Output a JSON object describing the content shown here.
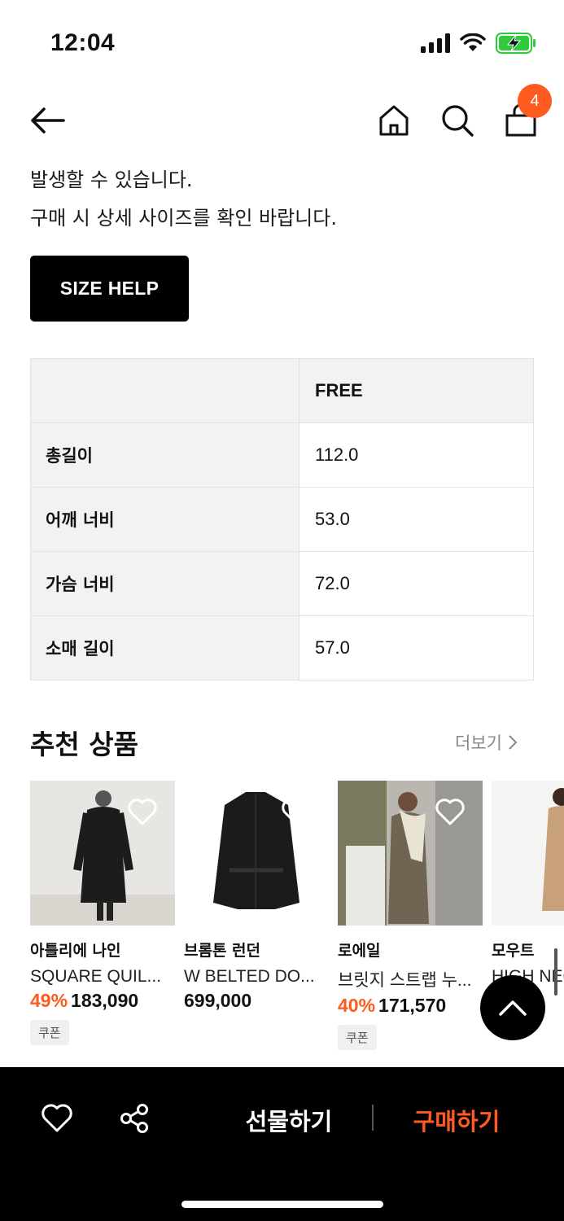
{
  "status": {
    "time": "12:04"
  },
  "nav": {
    "cart_count": "4"
  },
  "notice": {
    "line1": "발생할 수 있습니다.",
    "line2": "구매 시 상세 사이즈를 확인 바랍니다."
  },
  "size_help_label": "SIZE HELP",
  "size_table": {
    "header": "FREE",
    "rows": [
      {
        "label": "총길이",
        "value": "112.0"
      },
      {
        "label": "어깨 너비",
        "value": "53.0"
      },
      {
        "label": "가슴 너비",
        "value": "72.0"
      },
      {
        "label": "소매 길이",
        "value": "57.0"
      }
    ]
  },
  "recommended": {
    "title": "추천 상품",
    "more_label": "더보기",
    "products": [
      {
        "brand": "아틀리에 나인",
        "name": "SQUARE QUIL...",
        "discount": "49%",
        "price": "183,090",
        "coupon": "쿠폰"
      },
      {
        "brand": "브롬톤 런던",
        "name": "W BELTED DO...",
        "discount": "",
        "price": "699,000",
        "coupon": ""
      },
      {
        "brand": "로에일",
        "name": "브릿지 스트랩 누...",
        "discount": "40%",
        "price": "171,570",
        "coupon": "쿠폰"
      },
      {
        "brand": "모우트",
        "name": "HIGH NEC",
        "discount": "",
        "price": "00",
        "coupon": ""
      }
    ]
  },
  "bottom_bar": {
    "gift_label": "선물하기",
    "buy_label": "구매하기"
  },
  "colors": {
    "accent": "#ff5a1f",
    "bar_bg": "#000000"
  }
}
